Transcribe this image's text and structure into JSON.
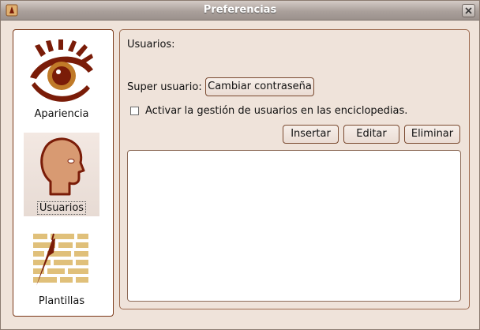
{
  "window": {
    "title": "Preferencias"
  },
  "sidebar": {
    "items": [
      {
        "label": "Apariencia",
        "icon": "eye-icon",
        "selected": false
      },
      {
        "label": "Usuarios",
        "icon": "user-head-icon",
        "selected": true
      },
      {
        "label": "Plantillas",
        "icon": "template-bricks-icon",
        "selected": false
      }
    ]
  },
  "panel": {
    "heading": "Usuarios:",
    "superuser_label": "Super usuario:",
    "change_password_button": "Cambiar contraseña",
    "enable_users_checkbox": {
      "label": "Activar la gestión de usuarios en las enciclopedias.",
      "checked": false
    },
    "actions": {
      "insert": "Insertar",
      "edit": "Editar",
      "delete": "Eliminar"
    },
    "user_list": []
  },
  "colors": {
    "accent": "#7a1c08",
    "panel_bg": "#efe3da",
    "head_skin": "#d89a72",
    "brick": "#e0c07a"
  }
}
